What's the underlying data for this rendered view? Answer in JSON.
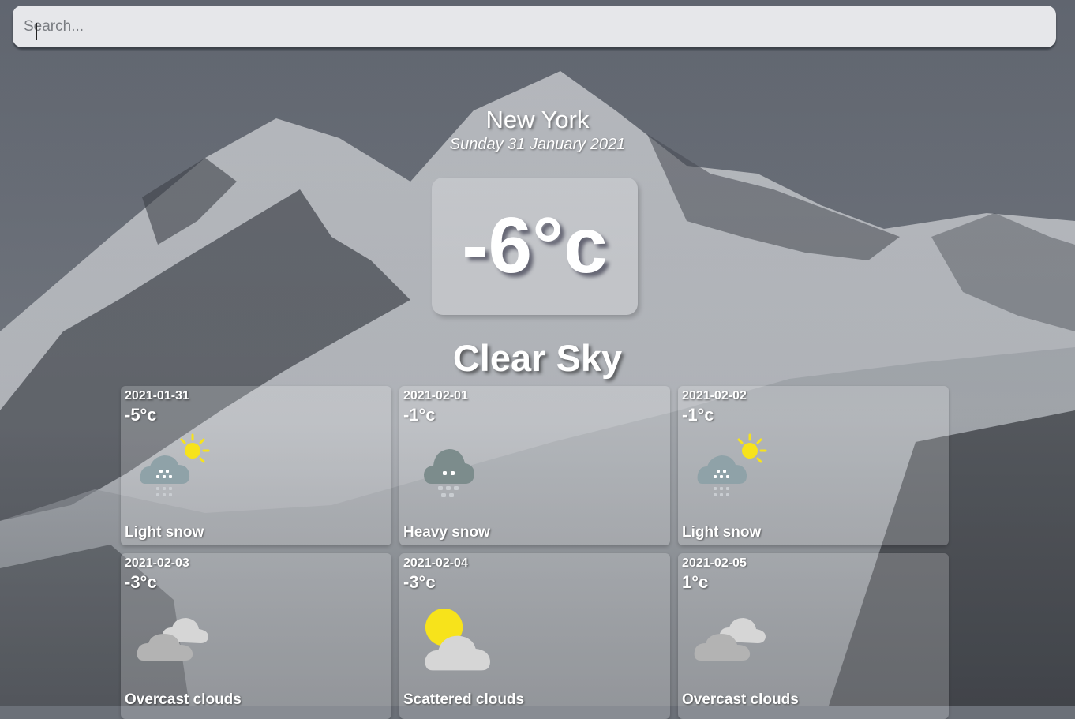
{
  "search": {
    "placeholder": "Search..."
  },
  "current": {
    "city": "New York",
    "date": "Sunday 31 January 2021",
    "temperature": "-6°c",
    "condition": "Clear Sky"
  },
  "forecast": [
    {
      "date": "2021-01-31",
      "temp": "-5°c",
      "description": "Light snow",
      "icon": "snow-sun-icon"
    },
    {
      "date": "2021-02-01",
      "temp": "-1°c",
      "description": "Heavy snow",
      "icon": "heavy-snow-icon"
    },
    {
      "date": "2021-02-02",
      "temp": "-1°c",
      "description": "Light snow",
      "icon": "snow-sun-icon"
    },
    {
      "date": "2021-02-03",
      "temp": "-3°c",
      "description": "Overcast clouds",
      "icon": "overcast-clouds-icon"
    },
    {
      "date": "2021-02-04",
      "temp": "-3°c",
      "description": "Scattered clouds",
      "icon": "scattered-clouds-icon"
    },
    {
      "date": "2021-02-05",
      "temp": "1°c",
      "description": "Overcast clouds",
      "icon": "overcast-clouds-icon"
    }
  ],
  "colors": {
    "sun": "#f7e31b",
    "snow_cloud": "#8fa2a8",
    "heavy_cloud": "#7c8c8c",
    "grey_cloud": "#b3b3b3",
    "light_cloud": "#d6d6d6",
    "search_bg": "#e6e7ea"
  }
}
